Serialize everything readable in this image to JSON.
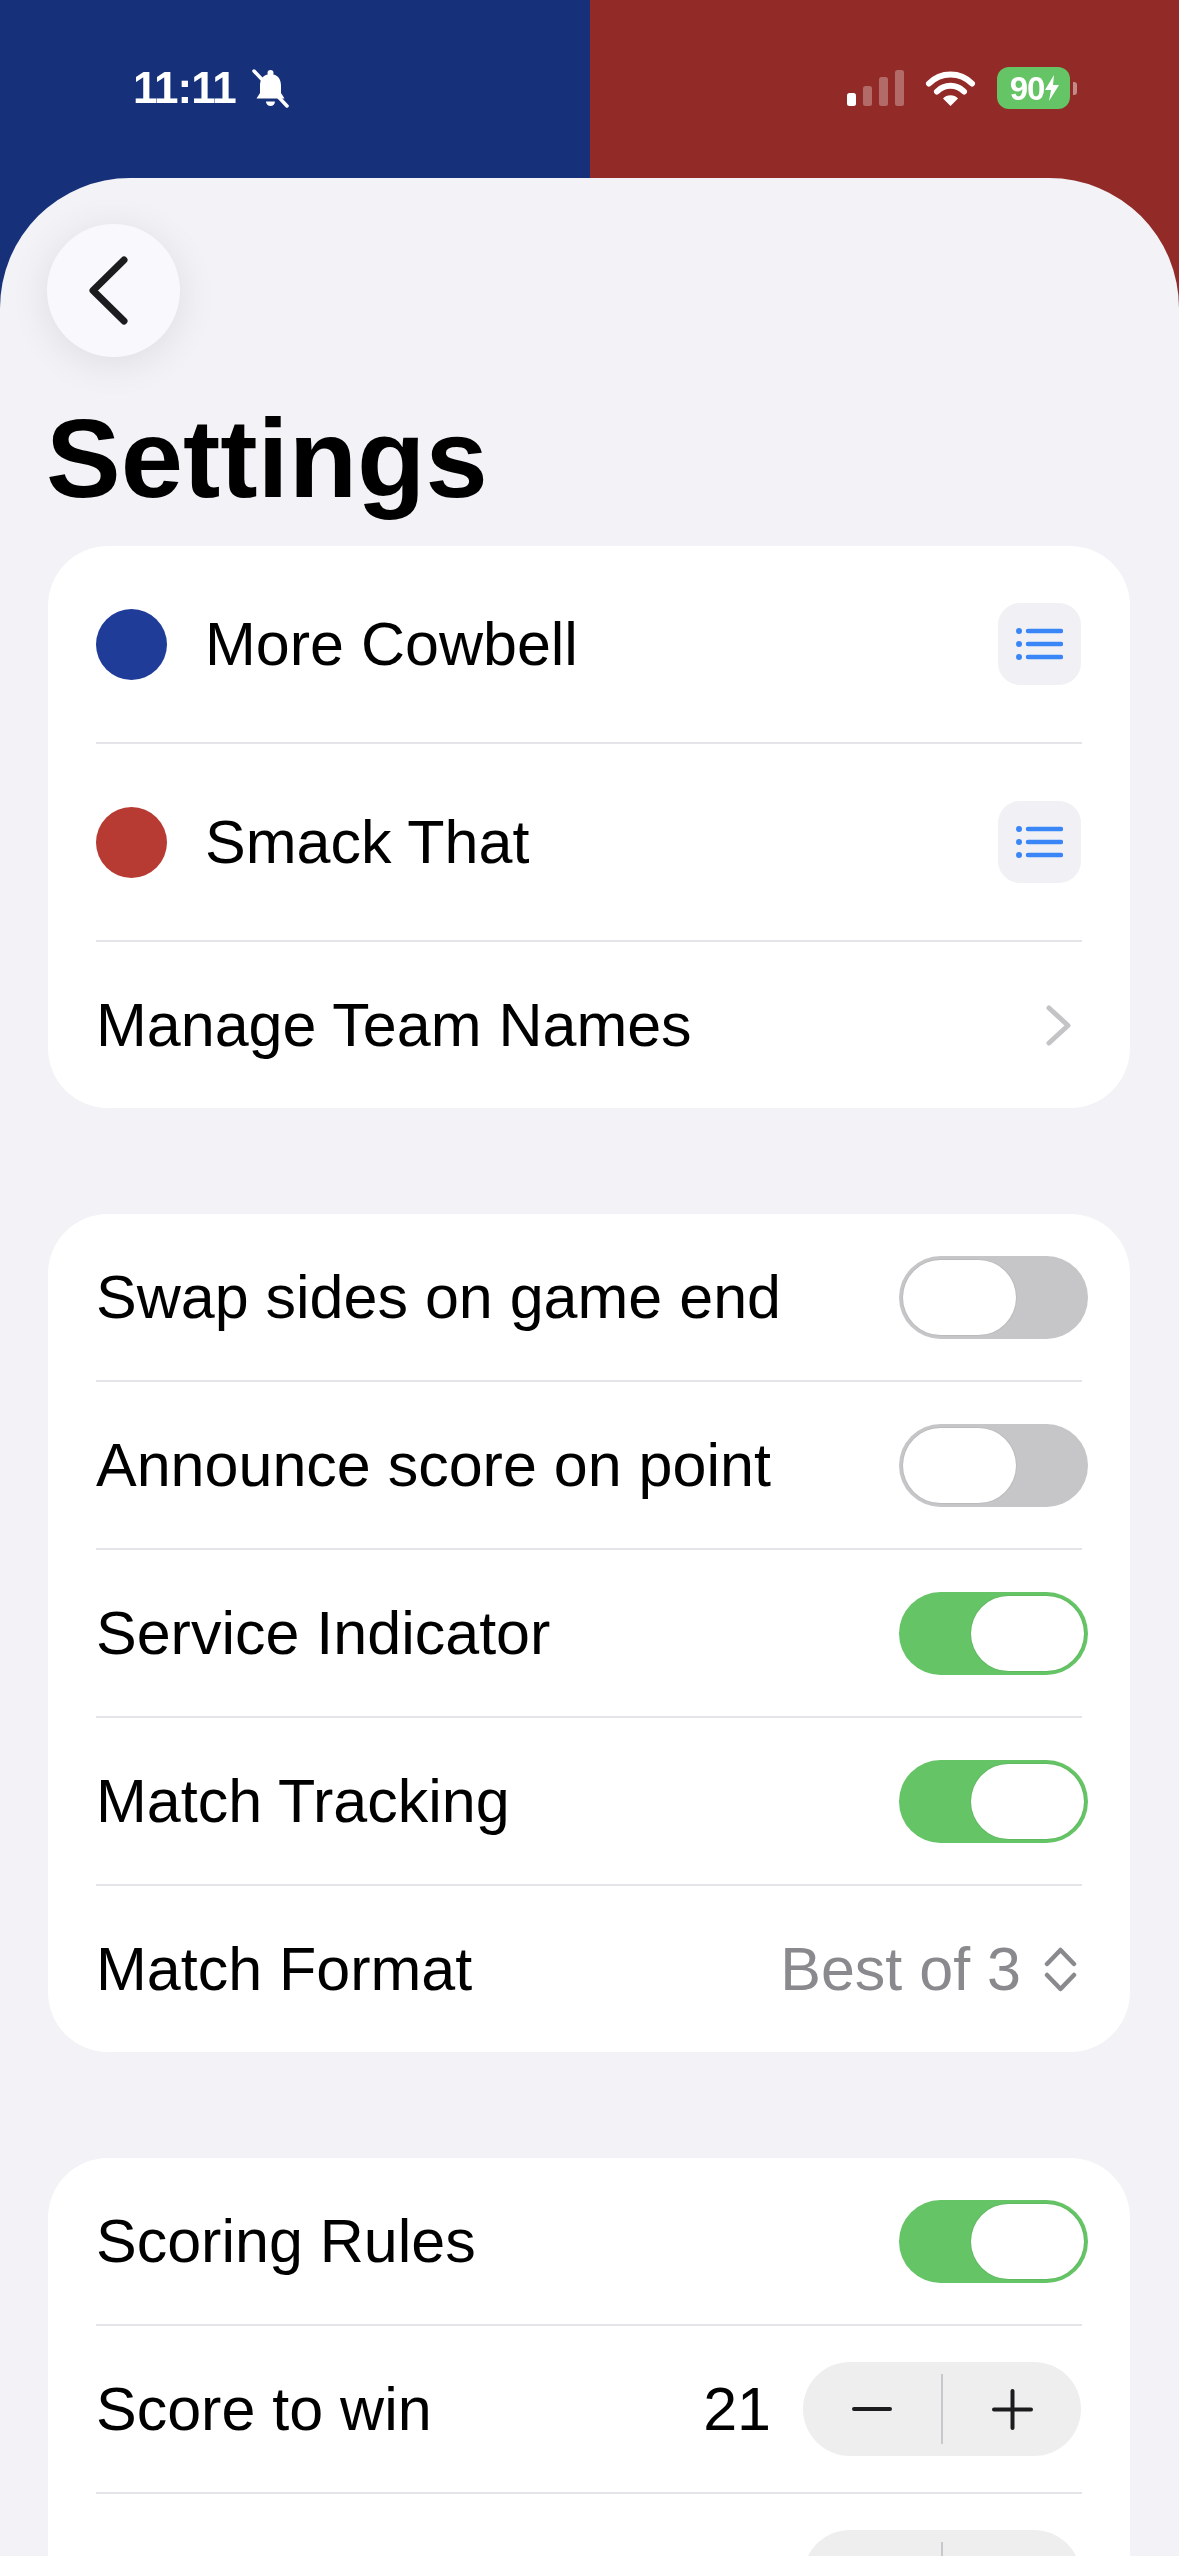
{
  "status_bar": {
    "time": "11:11",
    "battery": "90"
  },
  "title": "Settings",
  "sections": [
    {
      "rows": [
        {
          "kind": "team",
          "label": "More Cowbell",
          "color": "#1f3c99"
        },
        {
          "kind": "team",
          "label": "Smack That",
          "color": "#b73a33"
        },
        {
          "kind": "link",
          "label": "Manage Team Names"
        }
      ]
    },
    {
      "rows": [
        {
          "kind": "toggle",
          "label": "Swap sides on game end",
          "on": false
        },
        {
          "kind": "toggle",
          "label": "Announce score on point",
          "on": false
        },
        {
          "kind": "toggle",
          "label": "Service Indicator",
          "on": true
        },
        {
          "kind": "toggle",
          "label": "Match Tracking",
          "on": true
        },
        {
          "kind": "picker",
          "label": "Match Format",
          "value": "Best of 3"
        }
      ]
    },
    {
      "rows": [
        {
          "kind": "toggle",
          "label": "Scoring Rules",
          "on": true
        },
        {
          "kind": "stepper",
          "label": "Score to win",
          "value": "21"
        },
        {
          "kind": "clipped_stepper"
        }
      ]
    }
  ]
}
